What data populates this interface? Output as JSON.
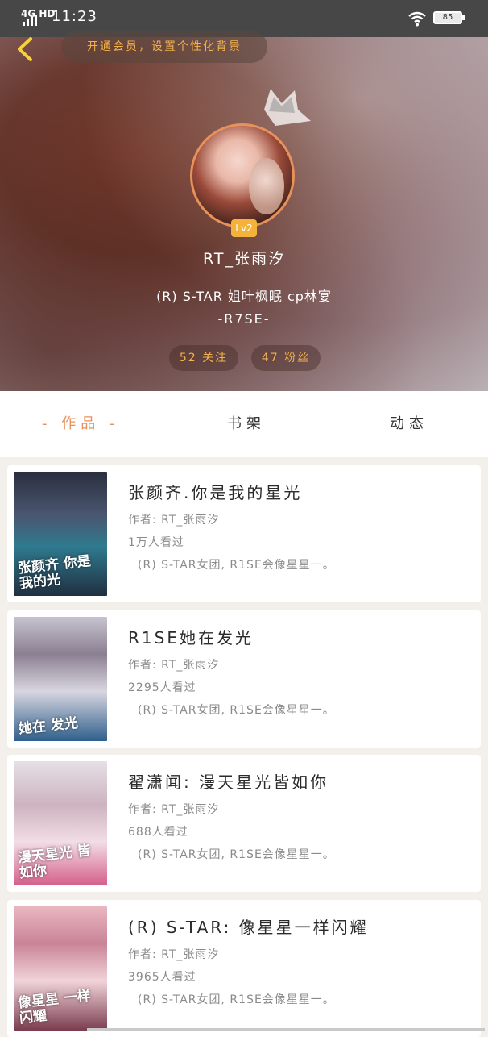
{
  "status_bar": {
    "network": "4G HD",
    "time": "11:23",
    "battery": "85"
  },
  "header": {
    "vip_banner": "开通会员，设置个性化背景"
  },
  "profile": {
    "level": "Lv2",
    "username": "RT_张雨汐",
    "bio_line1": "(R) S-TAR 姐叶枫眠 cp林宴",
    "bio_line2": "-R7SE-",
    "following": "52 关注",
    "fans": "47 粉丝"
  },
  "tabs": [
    {
      "label": "- 作品 -",
      "active": true
    },
    {
      "label": "书架",
      "active": false
    },
    {
      "label": "动态",
      "active": false
    }
  ],
  "works": [
    {
      "title": "张颜齐.你是我的星光",
      "author": "作者: RT_张雨汐",
      "views": "1万人看过",
      "desc": "(R) S-TAR女团, R1SE会像星星一。",
      "cover_text": "张颜齐 你是我的光"
    },
    {
      "title": "R1SE她在发光",
      "author": "作者: RT_张雨汐",
      "views": "2295人看过",
      "desc": "(R) S-TAR女团, R1SE会像星星一。",
      "cover_text": "她在 发光"
    },
    {
      "title": "翟潇闻: 漫天星光皆如你",
      "author": "作者: RT_张雨汐",
      "views": "688人看过",
      "desc": "(R) S-TAR女团, R1SE会像星星一。",
      "cover_text": "漫天星光 皆如你"
    },
    {
      "title": "(R) S-TAR: 像星星一样闪耀",
      "author": "作者: RT_张雨汐",
      "views": "3965人看过",
      "desc": "(R) S-TAR女团, R1SE会像星星一。",
      "cover_text": "像星星 一样闪耀"
    }
  ]
}
